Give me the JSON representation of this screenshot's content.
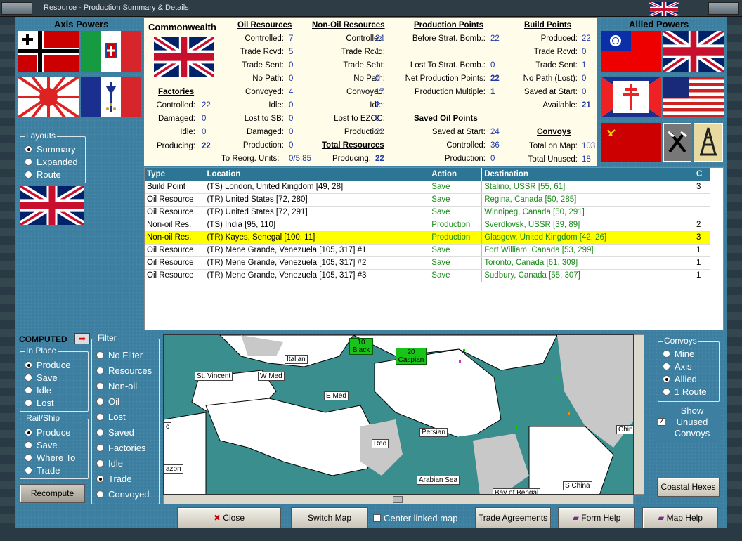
{
  "window": {
    "title": "Resource - Production Summary & Details"
  },
  "axis": {
    "heading": "Axis Powers"
  },
  "allied": {
    "heading": "Allied Powers"
  },
  "layouts": {
    "label": "Layouts",
    "options": [
      "Summary",
      "Expanded",
      "Route"
    ],
    "selected": "Summary"
  },
  "summary": {
    "country": "Commonwealth",
    "factories": {
      "heading": "Factories",
      "rows": [
        [
          "Controlled:",
          "22"
        ],
        [
          "Damaged:",
          "0"
        ],
        [
          "Idle:",
          "0"
        ],
        [
          "Producing:",
          "22"
        ]
      ]
    },
    "oil": {
      "heading": "Oil Resources",
      "rows": [
        [
          "Controlled:",
          "7"
        ],
        [
          "Trade Rcvd:",
          "5"
        ],
        [
          "Trade Sent:",
          "0"
        ],
        [
          "No Path:",
          "0"
        ],
        [
          "Convoyed:",
          "4"
        ],
        [
          "Idle:",
          "0"
        ],
        [
          "Lost to SB:",
          "0"
        ],
        [
          "Damaged:",
          "0"
        ],
        [
          "Production:",
          "0"
        ]
      ],
      "reorg_label": "To Reorg. Units:",
      "reorg_value": "0/5.85"
    },
    "nonoil": {
      "heading": "Non-Oil Resources",
      "rows": [
        [
          "Controlled:",
          "24"
        ],
        [
          "Trade Rcvd:",
          "1"
        ],
        [
          "Trade Sent:",
          "1"
        ],
        [
          "No Path:",
          "0"
        ],
        [
          "Convoyed:",
          "17"
        ],
        [
          "Idle:",
          "2"
        ],
        [
          "Lost to EZOC:",
          "0"
        ],
        [
          "Production:",
          "22"
        ]
      ]
    },
    "total": {
      "heading": "Total Resources",
      "label": "Producing:",
      "value": "22"
    },
    "pp": {
      "heading": "Production Points",
      "before_label": "Before Strat. Bomb.:",
      "before": "22",
      "lost_label": "Lost To Strat. Bomb.:",
      "lost": "0",
      "net_label": "Net Production Points:",
      "net": "22",
      "mult_label": "Production Multiple:",
      "mult": "1"
    },
    "saved_oil": {
      "heading": "Saved Oil Points",
      "rows": [
        [
          "Saved at Start:",
          "24"
        ],
        [
          "Controlled:",
          "36"
        ],
        [
          "Production:",
          "0"
        ]
      ]
    },
    "bp": {
      "heading": "Build Points",
      "rows": [
        [
          "Produced:",
          "22"
        ],
        [
          "Trade Rcvd:",
          "0"
        ],
        [
          "Trade Sent:",
          "1"
        ],
        [
          "No Path (Lost):",
          "0"
        ],
        [
          "Saved at Start:",
          "0"
        ],
        [
          "Available:",
          "21"
        ]
      ]
    },
    "convoys": {
      "heading": "Convoys",
      "rows": [
        [
          "Total on Map:",
          "103"
        ],
        [
          "Total Unused:",
          "18"
        ]
      ]
    }
  },
  "table": {
    "columns": [
      "Type",
      "Location",
      "Action",
      "Destination",
      "C"
    ],
    "rows": [
      {
        "type": "Build Point",
        "location": "(TS) London, United Kingdom [49, 28]",
        "action": "Save",
        "destination": "Stalino, USSR [55, 61]",
        "c": "3"
      },
      {
        "type": "Oil Resource",
        "location": "(TR) United States [72, 280]",
        "action": "Save",
        "destination": "Regina, Canada [50, 285]",
        "c": ""
      },
      {
        "type": "Oil Resource",
        "location": "(TR) United States [72, 291]",
        "action": "Save",
        "destination": "Winnipeg, Canada [50, 291]",
        "c": ""
      },
      {
        "type": "Non-oil Res.",
        "location": "(TS) India [95, 110]",
        "action": "Production",
        "destination": "Sverdlovsk, USSR [39, 89]",
        "c": "2"
      },
      {
        "type": "Non-oil Res.",
        "location": "(TR) Kayes, Senegal [100, 11]",
        "action": "Production",
        "destination": "Glasgow, United Kingdom [42, 26]",
        "c": "3"
      },
      {
        "type": "Oil Resource",
        "location": "(TR) Mene Grande, Venezuela [105, 317] #1",
        "action": "Save",
        "destination": "Fort William, Canada [53, 299]",
        "c": "1"
      },
      {
        "type": "Oil Resource",
        "location": "(TR) Mene Grande, Venezuela [105, 317] #2",
        "action": "Save",
        "destination": "Toronto, Canada [61, 309]",
        "c": "1"
      },
      {
        "type": "Oil Resource",
        "location": "(TR) Mene Grande, Venezuela [105, 317] #3",
        "action": "Save",
        "destination": "Sudbury, Canada [55, 307]",
        "c": "1"
      }
    ],
    "selected_index": 4
  },
  "computed_label": "COMPUTED",
  "in_place": {
    "label": "In Place",
    "options": [
      "Produce",
      "Save",
      "Idle",
      "Lost"
    ],
    "selected": "Produce"
  },
  "rail_ship": {
    "label": "Rail/Ship",
    "options": [
      "Produce",
      "Save",
      "Where To",
      "Trade"
    ],
    "selected": "Produce"
  },
  "recompute_label": "Recompute",
  "filter": {
    "label": "Filter",
    "options": [
      "No Filter",
      "Resources",
      "Non-oil",
      "Oil",
      "Lost",
      "Saved",
      "Factories",
      "Idle",
      "Trade",
      "Convoyed"
    ],
    "selected": "Trade"
  },
  "convoys_opts": {
    "label": "Convoys",
    "options": [
      "Mine",
      "Axis",
      "Allied",
      "1 Route"
    ],
    "selected": "Allied"
  },
  "show_unused": {
    "label": "Show Unused Convoys",
    "checked": true
  },
  "map": {
    "labels": [
      "St. Vincent",
      "W Med",
      "Italian",
      "E Med",
      "Persian",
      "Red",
      "Arabian Sea",
      "Bay of Bengal",
      "S China",
      "Chin",
      "azon",
      "c"
    ],
    "tags": [
      "10 Black",
      "20 Caspian"
    ]
  },
  "buttons": {
    "close": "Close",
    "switch_map": "Switch Map",
    "center_linked": "Center linked map",
    "trade_agreements": "Trade Agreements",
    "form_help": "Form Help",
    "map_help": "Map Help",
    "coastal_hexes": "Coastal Hexes"
  },
  "colors": {
    "accent": "#2c7594",
    "panel_bg": "#fffce9",
    "selected_row": "#ffff00",
    "action_green": "#1a8a1a",
    "value_blue": "#1e3aa8"
  }
}
